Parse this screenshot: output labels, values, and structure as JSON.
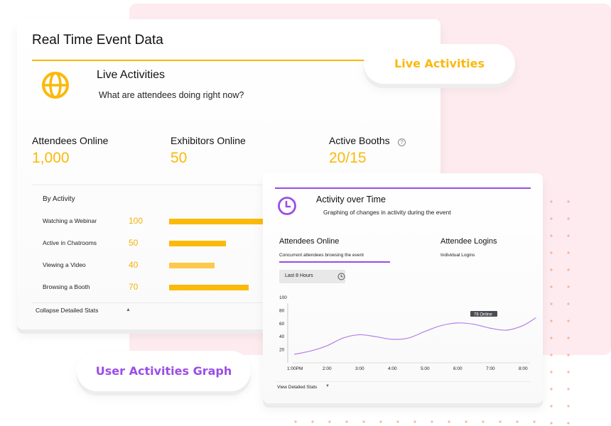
{
  "main_card": {
    "title": "Real Time Event Data",
    "section": {
      "icon": "globe-icon",
      "title": "Live Activities",
      "subtitle": "What are attendees doing right now?"
    },
    "stats": [
      {
        "label": "Attendees Online",
        "value": "1,000"
      },
      {
        "label": "Exhibitors Online",
        "value": "50"
      },
      {
        "label": "Active Booths",
        "value": "20/15",
        "help_icon": "question-circle-icon"
      }
    ],
    "by_activity": {
      "heading": "By Activity",
      "max": 100,
      "rows": [
        {
          "label": "Watching a Webinar",
          "value": 100,
          "value_text": "100"
        },
        {
          "label": "Active in Chatrooms",
          "value": 50,
          "value_text": "50"
        },
        {
          "label": "Viewing a Video",
          "value": 40,
          "value_text": "40"
        },
        {
          "label": "Browsing a Booth",
          "value": 70,
          "value_text": "70"
        }
      ]
    },
    "collapse_label": "Collapse Detailed Stats",
    "collapse_icon": "caret-up-icon"
  },
  "pills": {
    "live_activities": "Live Activities",
    "user_activities_graph": "User Activities Graph"
  },
  "graph_card": {
    "icon": "clock-icon",
    "title": "Activity over Time",
    "subtitle": "Graphing of changes in activity during the event",
    "tabs": [
      {
        "title": "Attendees Online",
        "subtitle": "Concurrent attendees browsing the event",
        "active": true
      },
      {
        "title": "Attendee Logins",
        "subtitle": "Individual Logins",
        "active": false
      }
    ],
    "range_select": {
      "value": "Last 8 Hours",
      "icon": "clock-icon"
    },
    "view_detailed_label": "View Detailed Stats",
    "view_detailed_icon": "caret-down-icon"
  },
  "chart_data": {
    "type": "line",
    "title": "Attendees Online",
    "x": [
      "1:00PM",
      "2:00",
      "3:00",
      "4:00",
      "5:00",
      "6:00",
      "7:00",
      "8:00"
    ],
    "series": [
      {
        "name": "Attendees Online",
        "color": "#b57ee8",
        "points": [
          [
            0,
            13
          ],
          [
            0.5,
            18
          ],
          [
            1,
            26
          ],
          [
            1.5,
            38
          ],
          [
            2,
            43
          ],
          [
            2.5,
            40
          ],
          [
            3,
            36
          ],
          [
            3.5,
            38
          ],
          [
            4,
            48
          ],
          [
            4.5,
            57
          ],
          [
            5,
            61
          ],
          [
            5.5,
            59
          ],
          [
            6,
            53
          ],
          [
            6.5,
            50
          ],
          [
            7,
            57
          ],
          [
            7.4,
            69
          ]
        ]
      }
    ],
    "yticks": [
      20,
      40,
      60,
      80,
      100
    ],
    "ylim": [
      0,
      100
    ],
    "tooltip": "78 Online",
    "grid": false,
    "xlabel": "",
    "ylabel": ""
  },
  "colors": {
    "accent_yellow": "#fbb90b",
    "accent_purple": "#9b4de6",
    "background_pink": "#fdebef",
    "dot_orange": "#f2a68a"
  }
}
